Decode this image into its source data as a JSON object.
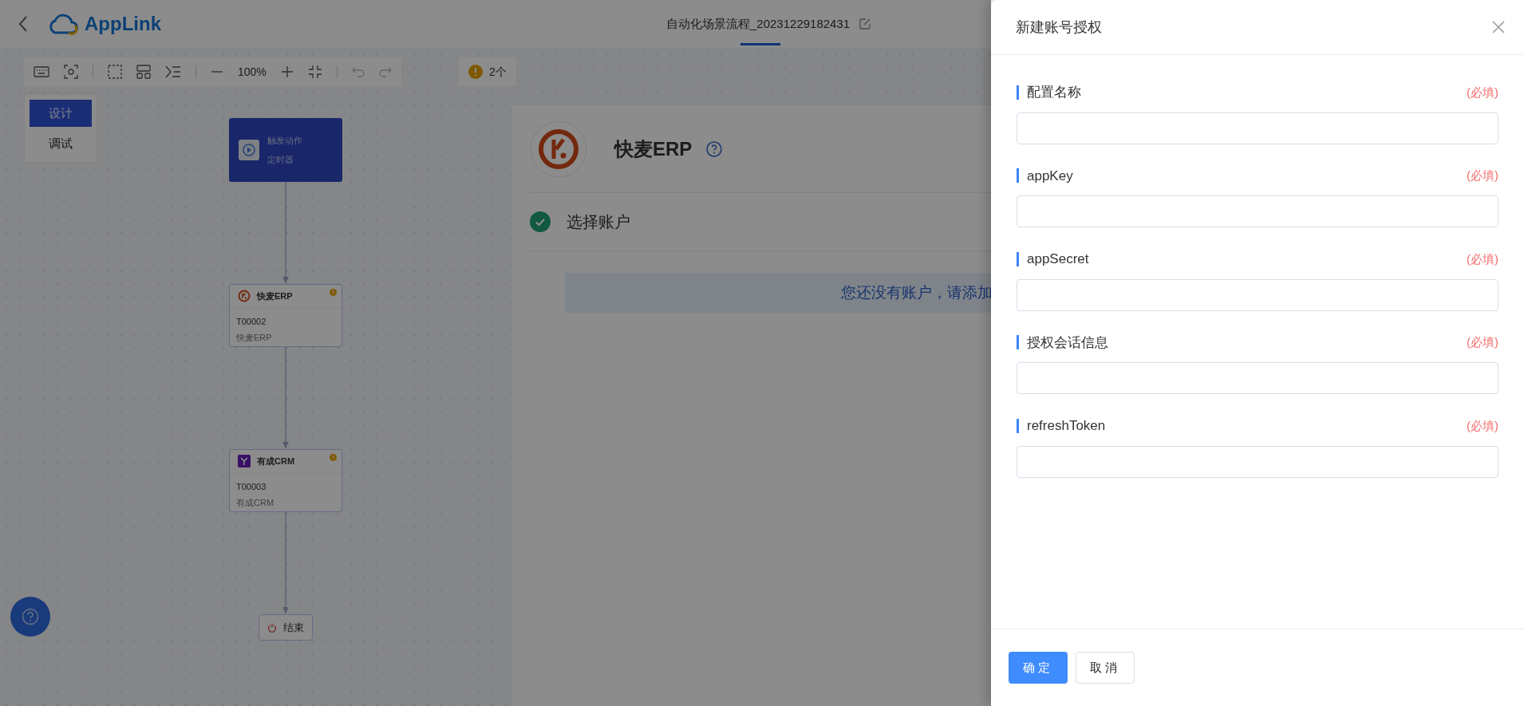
{
  "header": {
    "app_name": "AppLink",
    "flow_title": "自动化场景流程_20231229182431"
  },
  "toolbar": {
    "zoom": "100%",
    "warning_count": "2个"
  },
  "mode_tabs": [
    {
      "label": "设计",
      "selected": true
    },
    {
      "label": "调试",
      "selected": false
    }
  ],
  "flow_nodes": [
    {
      "kind": "trigger",
      "title": "触发动作",
      "subtitle": "定时器"
    },
    {
      "kind": "app",
      "title": "快麦ERP",
      "code": "T00002",
      "subtitle": "快麦ERP",
      "warning": true
    },
    {
      "kind": "app",
      "title": "有成CRM",
      "code": "T00003",
      "subtitle": "有成CRM",
      "warning": true
    },
    {
      "kind": "end",
      "title": "结束"
    }
  ],
  "connector_panel": {
    "app_title": "快麦ERP",
    "step": {
      "label": "选择账户",
      "done": true
    },
    "notice": "您还没有账户，请添加"
  },
  "drawer": {
    "title": "新建账号授权",
    "fields": [
      {
        "label": "配置名称",
        "required_mark": "(必填)"
      },
      {
        "label": "appKey",
        "required_mark": "(必填)"
      },
      {
        "label": "appSecret",
        "required_mark": "(必填)"
      },
      {
        "label": "授权会话信息",
        "required_mark": "(必填)"
      },
      {
        "label": "refreshToken",
        "required_mark": "(必填)"
      }
    ],
    "buttons": [
      {
        "label": "确定",
        "kind": "primary"
      },
      {
        "label": "取消",
        "kind": "secondary"
      }
    ]
  }
}
